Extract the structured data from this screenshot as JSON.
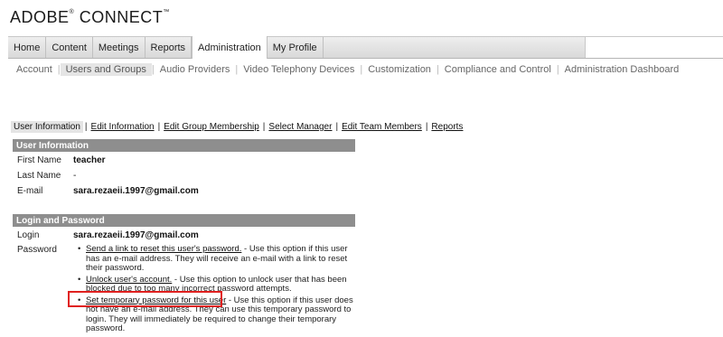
{
  "brand": {
    "name": "ADOBE",
    "suffix": "CONNECT",
    "reg": "®",
    "tm": "™"
  },
  "main_nav": [
    "Home",
    "Content",
    "Meetings",
    "Reports",
    "Administration",
    "My Profile"
  ],
  "main_nav_active": "Administration",
  "sub_nav": [
    "Account",
    "Users and Groups",
    "Audio Providers",
    "Video Telephony Devices",
    "Customization",
    "Compliance and Control",
    "Administration Dashboard"
  ],
  "sub_nav_active": "Users and Groups",
  "page_tabs": [
    "User Information",
    "Edit Information",
    "Edit Group Membership",
    "Select Manager",
    "Edit Team Members",
    "Reports"
  ],
  "page_tabs_active": "User Information",
  "user_info": {
    "header": "User Information",
    "first_name_label": "First Name",
    "first_name": "teacher",
    "last_name_label": "Last Name",
    "last_name": "-",
    "email_label": "E-mail",
    "email": "sara.rezaeii.1997@gmail.com"
  },
  "login_password": {
    "header": "Login and Password",
    "login_label": "Login",
    "login": "sara.rezaeii.1997@gmail.com",
    "password_label": "Password",
    "options": [
      {
        "link": "Send a link to reset this user's password.",
        "description": " -  Use this option if this user has an e-mail address. They will receive an e-mail with a link to reset their password."
      },
      {
        "link": "Unlock user's account.",
        "description": " -  Use this option to unlock user that has been blocked due to too many incorrect password attempts."
      },
      {
        "link": "Set temporary password for this user",
        "description": " -  Use this option if this user does not have an e-mail address. They can use this temporary password to login. They will immediately be required to change their temporary password."
      }
    ]
  },
  "colors": {
    "highlight": "#e0201f",
    "section_header": "#8e8e8e"
  }
}
